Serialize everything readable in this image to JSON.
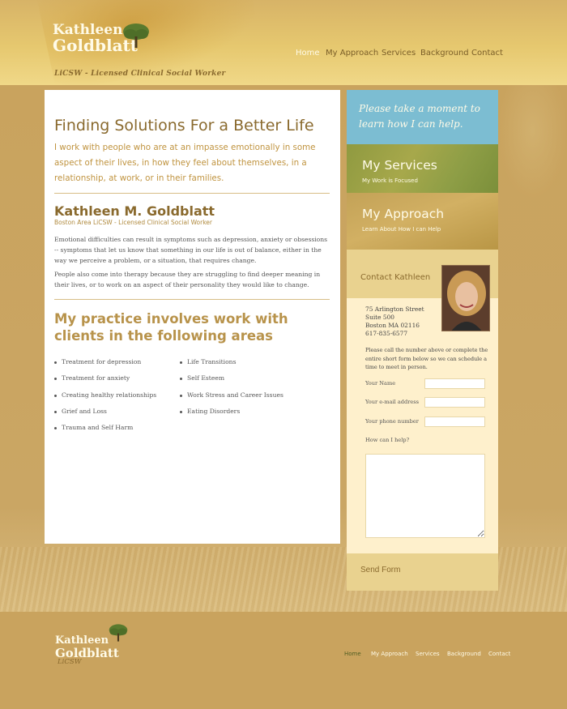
{
  "header": {
    "logo": {
      "first": "Kathleen",
      "last": "Goldblatt",
      "tagline": "LiCSW - Licensed Clinical Social Worker"
    },
    "nav": [
      {
        "label": "Home",
        "active": true
      },
      {
        "label": "My Approach",
        "active": false
      },
      {
        "label": "Services",
        "active": false
      },
      {
        "label": "Background",
        "active": false
      },
      {
        "label": "Contact",
        "active": false
      }
    ]
  },
  "main": {
    "heading": "Finding Solutions For a Better Life",
    "intro": "I work with people who are at an impasse emotionally in some aspect of their lives, in how they feel about themselves, in a relationship, at work, or in their families.",
    "name_heading": "Kathleen M. Goldblatt",
    "name_subline": "Boston Area LiCSW - Licensed Clinical Social Worker",
    "paragraphs": [
      "Emotional difficulties can result in symptoms such as depression, anxiety or obsessions -- symptoms that let us know that something in our life is out of balance, either in the way we perceive a problem, or a situation, that requires change.",
      "People also come into therapy because they are struggling to find deeper meaning in their lives, or to work on an aspect of their personality they would like to change."
    ],
    "practice_heading": "My practice involves work with clients in the following areas",
    "areas_left": [
      "Treatment for depression",
      "Treatment for anxiety",
      "Creating healthy relationships",
      "Grief and Loss",
      "Trauma and Self Harm"
    ],
    "areas_right": [
      "Life Transitions",
      "Self Esteem",
      "Work Stress and Career Issues",
      "Eating Disorders"
    ]
  },
  "sidebar": {
    "banner": "Please take a moment to learn how I can help.",
    "services": {
      "title": "My Services",
      "subtitle": "My Work is Focused"
    },
    "approach": {
      "title": "My Approach",
      "subtitle": "Learn About How I can Help"
    },
    "contact": {
      "title": "Contact Kathleen",
      "address": [
        "75 Arlington Street",
        "Suite 500",
        "Boston MA 02116",
        "617-835-6577"
      ],
      "instructions": "Please call the number above or complete the entire short form below so we can schedule a time to meet in person.",
      "fields": [
        {
          "label": "Your Name",
          "value": ""
        },
        {
          "label": "Your e-mail address",
          "value": ""
        },
        {
          "label": "Your phone number",
          "value": ""
        }
      ],
      "help_label": "How can I help?",
      "send_label": "Send Form"
    }
  },
  "footer": {
    "logo": {
      "first": "Kathleen",
      "last": "Goldblatt",
      "tagline": "LiCSW"
    },
    "nav": [
      {
        "label": "Home",
        "active": true
      },
      {
        "label": "My Approach",
        "active": false
      },
      {
        "label": "Services",
        "active": false
      },
      {
        "label": "Background",
        "active": false
      },
      {
        "label": "Contact",
        "active": false
      }
    ]
  },
  "colors": {
    "background": "#c9a35e",
    "banner_blue": "#7cbdd2",
    "services_green": "#a7a84b",
    "heading_brown": "#8a6a2e",
    "contact_panel": "#fef0cc"
  },
  "icons": [
    "tree-icon",
    "tree-icon"
  ]
}
